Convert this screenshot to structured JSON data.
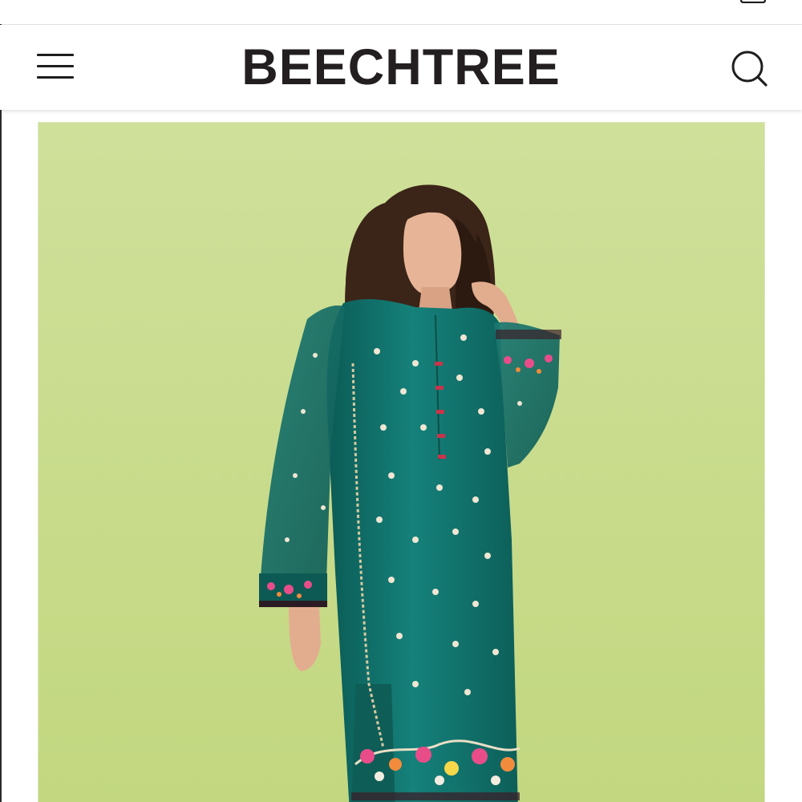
{
  "header": {
    "brand": "BEECHTREE",
    "menu_icon": "hamburger-menu-icon",
    "search_icon": "search-icon",
    "cart_icon": "shopping-bag-icon"
  },
  "hero": {
    "background_color": "#c9dc8a",
    "garment_color": "#0f6b63",
    "embroidery_colors": [
      "#e84d8a",
      "#f28b3b",
      "#f3ece0"
    ]
  }
}
